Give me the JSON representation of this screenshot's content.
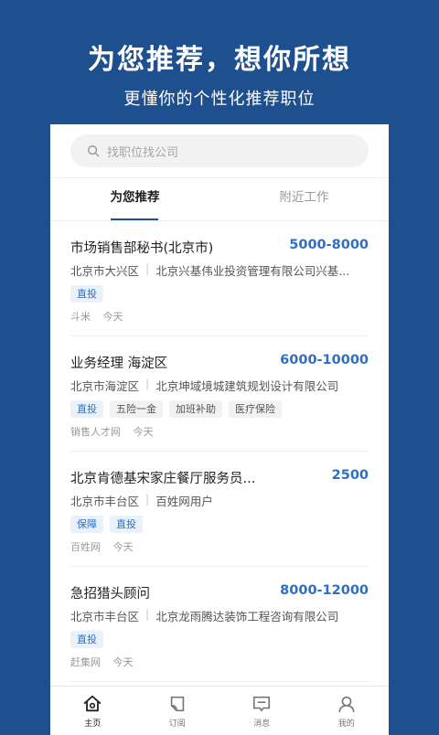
{
  "hero": {
    "title": "为您推荐，想你所想",
    "subtitle": "更懂你的个性化推荐职位"
  },
  "search": {
    "placeholder": "找职位找公司",
    "icon": "search-icon"
  },
  "tabs": [
    {
      "label": "为您推荐",
      "active": true
    },
    {
      "label": "附近工作",
      "active": false
    }
  ],
  "jobs": [
    {
      "title": "市场销售部秘书(北京市)",
      "salary": "5000-8000",
      "location": "北京市大兴区",
      "company": "北京兴基伟业投资管理有限公司兴基...",
      "tags": [
        {
          "text": "直投",
          "style": "blue"
        }
      ],
      "source": "斗米",
      "date": "今天"
    },
    {
      "title": "业务经理 海淀区",
      "salary": "6000-10000",
      "location": "北京市海淀区",
      "company": "北京坤域境城建筑规划设计有限公司",
      "tags": [
        {
          "text": "直投",
          "style": "blue"
        },
        {
          "text": "五险一金",
          "style": "gray"
        },
        {
          "text": "加班补助",
          "style": "gray"
        },
        {
          "text": "医疗保险",
          "style": "gray"
        }
      ],
      "source": "销售人才网",
      "date": "今天"
    },
    {
      "title": "北京肯德基宋家庄餐厅服务员...",
      "salary": "2500",
      "location": "北京市丰台区",
      "company": "百姓网用户",
      "tags": [
        {
          "text": "保障",
          "style": "blue"
        },
        {
          "text": "直投",
          "style": "blue"
        }
      ],
      "source": "百姓网",
      "date": "今天"
    },
    {
      "title": "急招猎头顾问",
      "salary": "8000-12000",
      "location": "北京市丰台区",
      "company": "北京龙雨腾达装饰工程咨询有限公司",
      "tags": [
        {
          "text": "直投",
          "style": "blue"
        }
      ],
      "source": "赶集网",
      "date": "今天"
    }
  ],
  "bottom_nav": [
    {
      "label": "主页",
      "icon": "home-icon",
      "active": true
    },
    {
      "label": "订阅",
      "icon": "subscribe-icon",
      "active": false
    },
    {
      "label": "消息",
      "icon": "message-icon",
      "active": false
    },
    {
      "label": "我的",
      "icon": "profile-icon",
      "active": false
    }
  ],
  "colors": {
    "brand": "#1e4f8f",
    "salary": "#2f6fc0"
  }
}
